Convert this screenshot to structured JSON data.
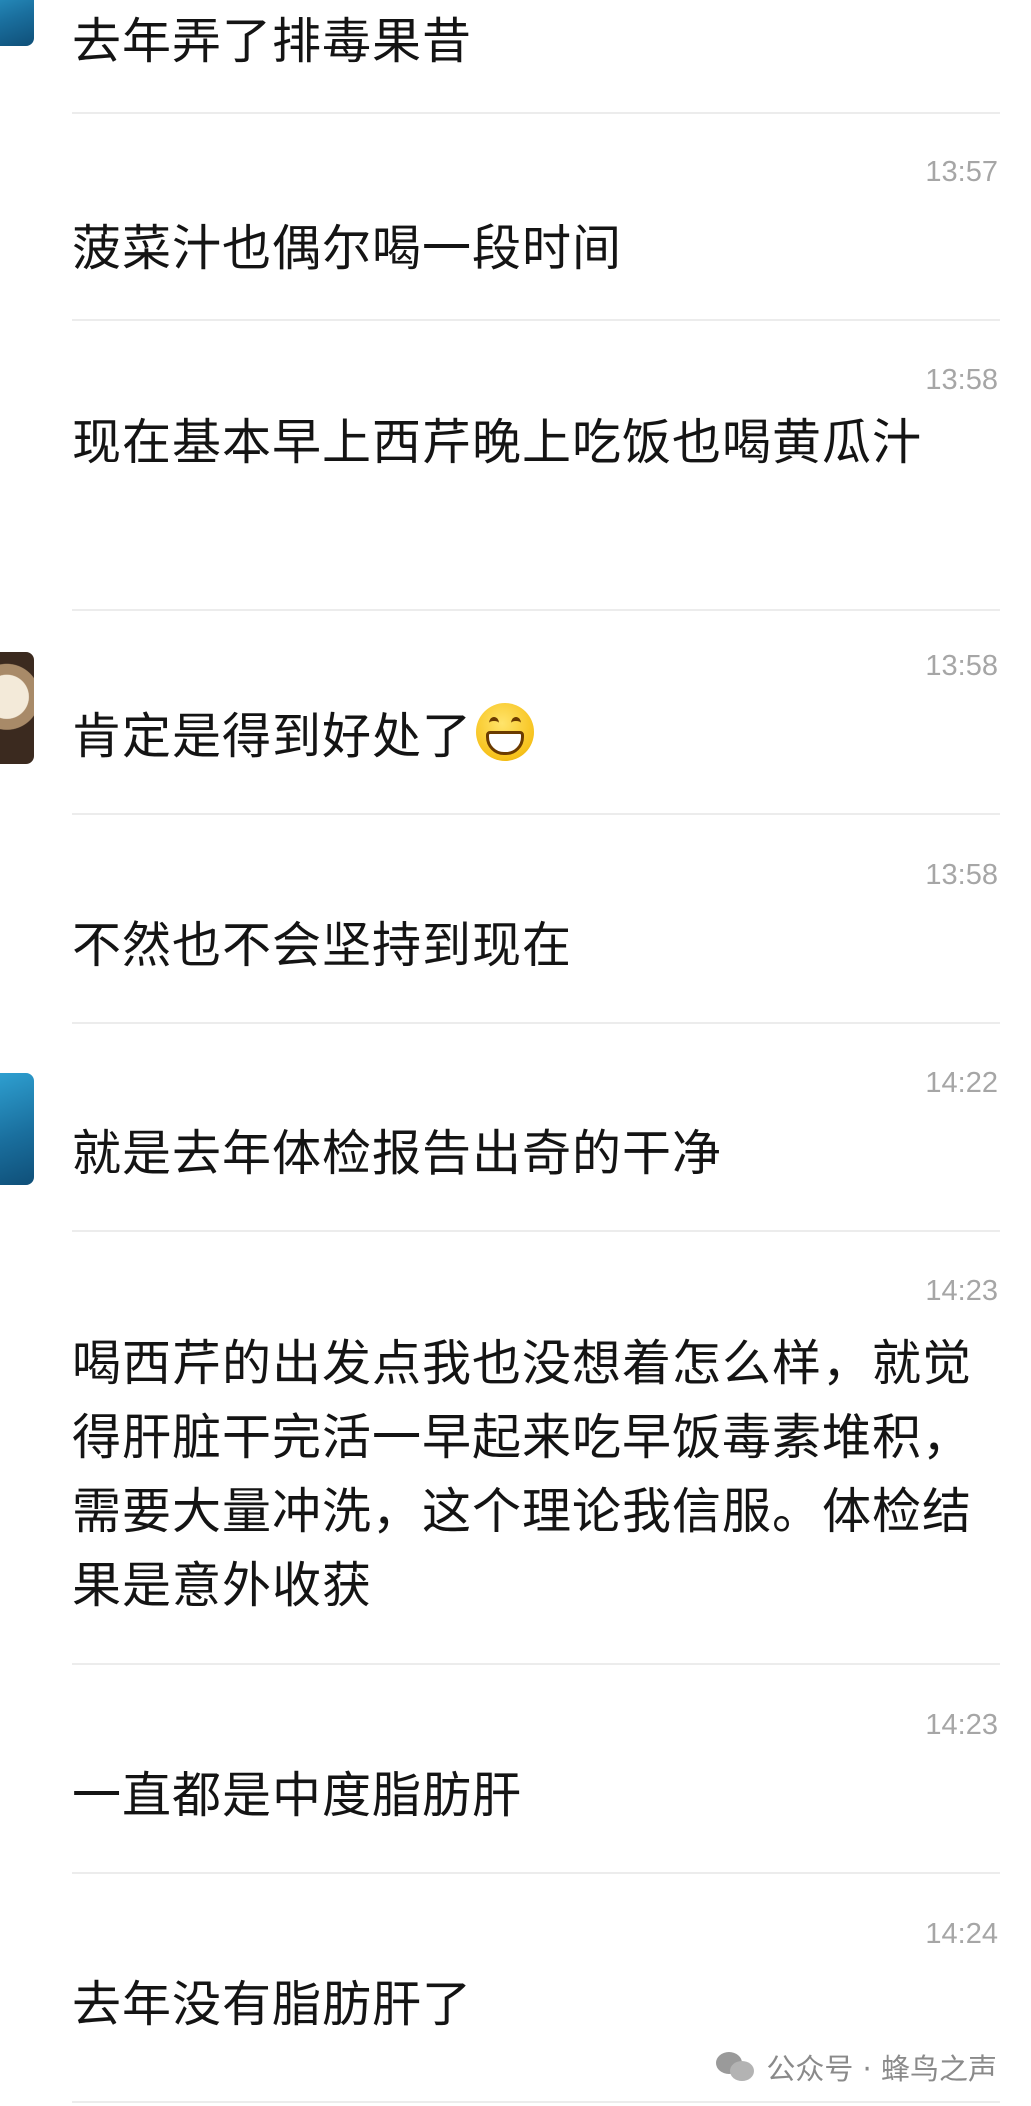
{
  "messages": [
    {
      "sender": "",
      "time": "",
      "text": "去年弄了排毒果昔",
      "avatar": "blue"
    },
    {
      "sender": "",
      "time": "13:57",
      "text": "菠菜汁也偶尔喝一段时间",
      "avatar": ""
    },
    {
      "sender": "",
      "time": "13:58",
      "text": "现在基本早上西芹晚上吃饭也喝黄瓜汁",
      "avatar": ""
    },
    {
      "sender": "",
      "time": "13:58",
      "text": "肯定是得到好处了",
      "avatar": "coffee",
      "emoji": "grinning-face-emoji"
    },
    {
      "sender": "",
      "time": "13:58",
      "text": "不然也不会坚持到现在",
      "avatar": ""
    },
    {
      "sender": "",
      "time": "14:22",
      "text": "就是去年体检报告出奇的干净",
      "avatar": "blue"
    },
    {
      "sender": "",
      "time": "14:23",
      "text": "喝西芹的出发点我也没想着怎么样，就觉得肝脏干完活一早起来吃早饭毒素堆积，需要大量冲洗，这个理论我信服。体检结果是意外收获",
      "avatar": ""
    },
    {
      "sender": "",
      "time": "14:23",
      "text": "一直都是中度脂肪肝",
      "avatar": ""
    },
    {
      "sender": "",
      "time": "14:24",
      "text": "去年没有脂肪肝了",
      "avatar": ""
    }
  ],
  "watermark": {
    "text": "公众号 · 蜂鸟之声",
    "icon": "wechat-icon"
  }
}
